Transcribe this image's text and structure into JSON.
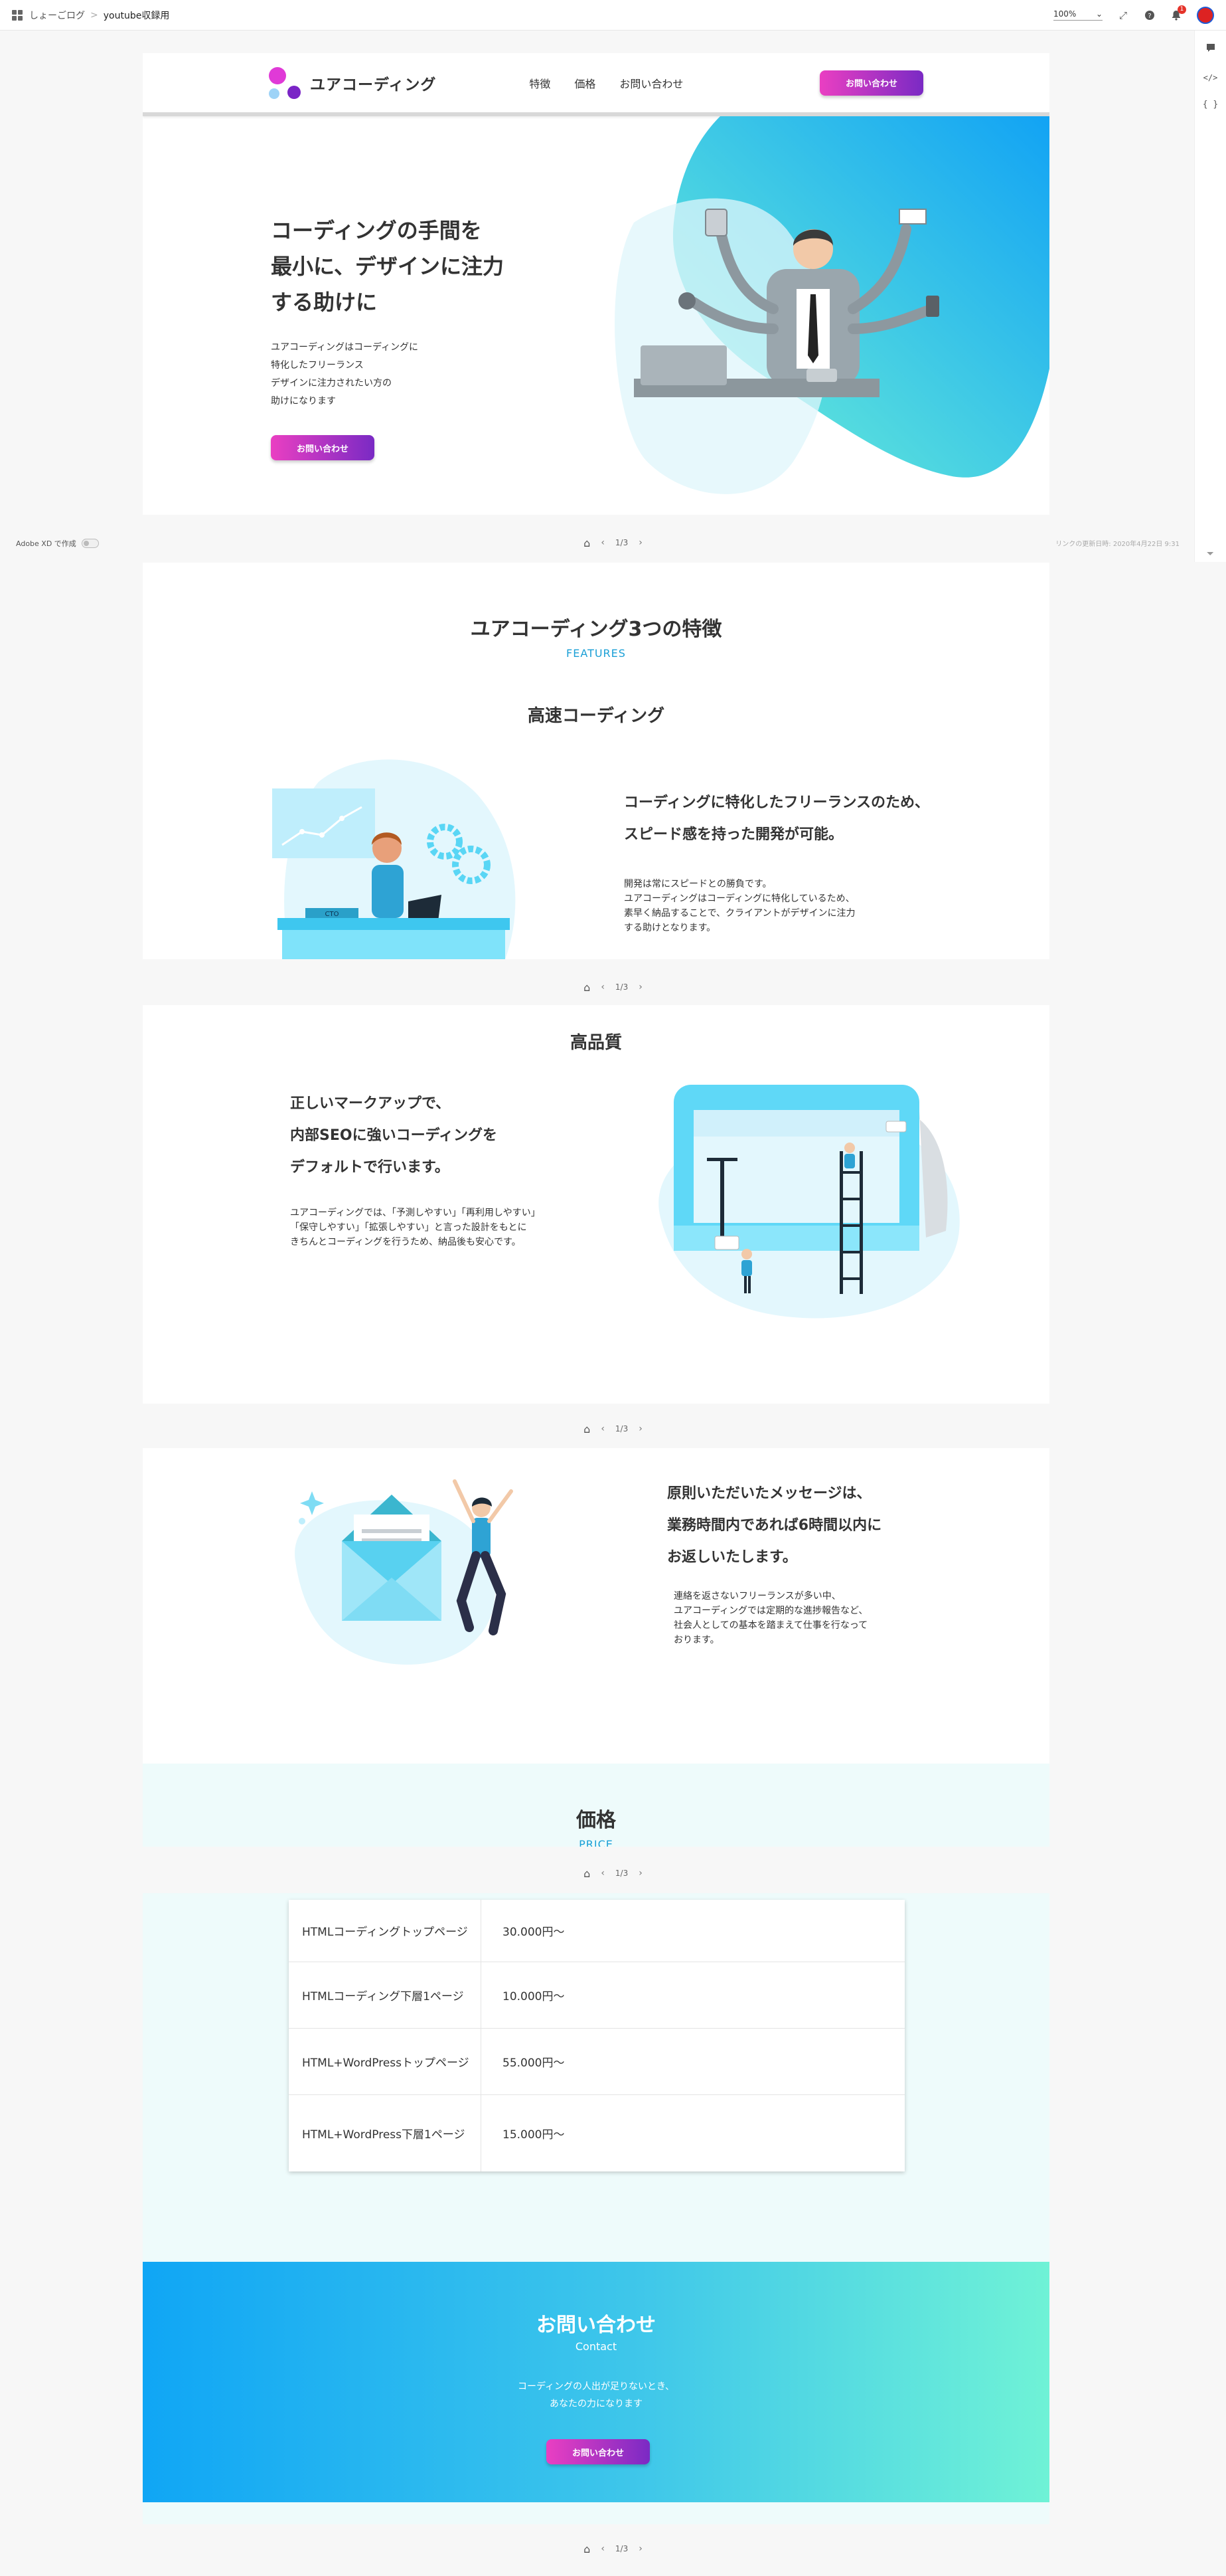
{
  "xd": {
    "breadcrumb_root": "しょーごログ",
    "breadcrumb_sep": ">",
    "breadcrumb_current": "youtube収録用",
    "zoom": "100%",
    "notification_count": "1",
    "made_with": "Adobe XD で作成",
    "updated": "リンクの更新日時: 2020年4月22日 9:31",
    "pager": [
      {
        "label": "1/3"
      },
      {
        "label": "1/3"
      },
      {
        "label": "1/3"
      },
      {
        "label": "1/3"
      },
      {
        "label": "1/3"
      }
    ]
  },
  "header": {
    "logo": "ユアコーディング",
    "nav": [
      "特徴",
      "価格",
      "お問い合わせ"
    ],
    "button": "お問い合わせ"
  },
  "hero": {
    "title": "コーディングの手間を\n最小に、デザインに注力\nする助けに",
    "desc": "ユアコーディングはコーディングに\n特化したフリーランス\nデザインに注力されたい方の\n助けになります",
    "button": "お問い合わせ"
  },
  "features": {
    "title": "ユアコーディング3つの特徴",
    "subtitle": "FEATURES",
    "f1": {
      "label": "高速コーディング",
      "heading": "コーディングに特化したフリーランスのため、\nスピード感を持った開発が可能。",
      "body": "開発は常にスピードとの勝負です。\nユアコーディングはコーディングに特化しているため、\n素早く納品することで、クライアントがデザインに注力\nする助けとなります。",
      "sign": "CTO"
    },
    "f2": {
      "label": "高品質",
      "heading": "正しいマークアップで、\n内部SEOに強いコーディングを\nデフォルトで行います。",
      "body": "ユアコーディングでは、「予測しやすい」「再利用しやすい」\n「保守しやすい」「拡張しやすい」と言った設計をもとに\nきちんとコーディングを行うため、納品後も安心です。"
    },
    "f3": {
      "heading": "原則いただいたメッセージは、\n業務時間内であれば6時間以内に\nお返しいたします。",
      "body": "連絡を返さないフリーランスが多い中、\nユアコーディングでは定期的な進捗報告など、\n社会人としての基本を踏まえて仕事を行なって\nおります。"
    }
  },
  "price": {
    "title": "価格",
    "subtitle": "PRICE",
    "rows": [
      {
        "name": "HTMLコーディングトップページ",
        "value": "30.000円〜"
      },
      {
        "name": "HTMLコーディング下層1ページ",
        "value": "10.000円〜"
      },
      {
        "name": "HTML+WordPressトップページ",
        "value": "55.000円〜"
      },
      {
        "name": "HTML+WordPress下層1ページ",
        "value": "15.000円〜"
      }
    ]
  },
  "contact": {
    "title": "お問い合わせ",
    "subtitle": "Contact",
    "desc": "コーディングの人出が足りないとき、\nあなたの力になります",
    "button": "お問い合わせ"
  },
  "colors": {
    "accent_pink": "#ea3fc2",
    "accent_purple": "#7a2ac4",
    "cyan": "#1a9fd6",
    "mint": "#6ff2d6"
  }
}
